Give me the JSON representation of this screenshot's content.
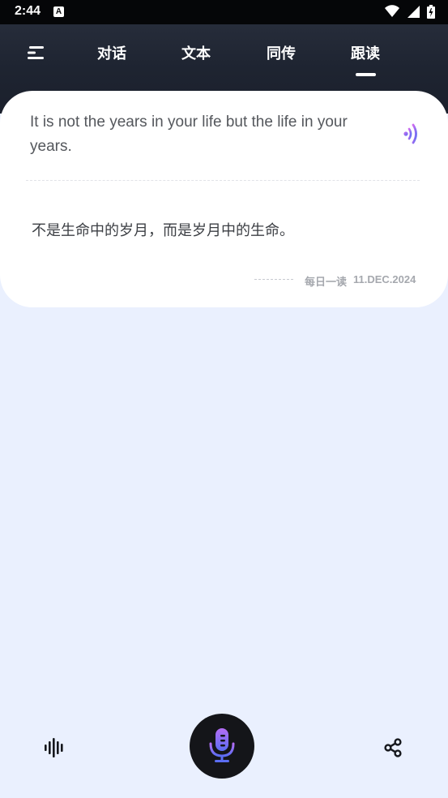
{
  "status_bar": {
    "time": "2:44",
    "notification_icon": "A"
  },
  "nav": {
    "menu_icon": "menu-icon",
    "tabs": [
      {
        "label": "对话"
      },
      {
        "label": "文本"
      },
      {
        "label": "同传"
      },
      {
        "label": "跟读",
        "active": true
      }
    ]
  },
  "card": {
    "english_sentence": "It is not the years in your life but the life in your years.",
    "chinese_sentence": "不是生命中的岁月，而是岁月中的生命。",
    "daily_label": "每日一读",
    "date": "11.DEC.2024"
  },
  "bottom_bar": {
    "left_icon": "waveform-icon",
    "center_icon": "microphone-icon",
    "right_icon": "share-icon"
  },
  "colors": {
    "header_bg": "#1f2532",
    "page_bg": "#eaf0fe",
    "accent_purple": "#a86cf5",
    "accent_blue": "#5b6df2"
  }
}
